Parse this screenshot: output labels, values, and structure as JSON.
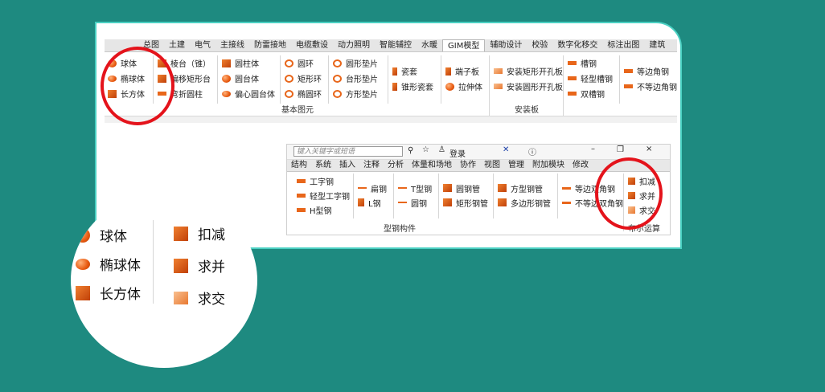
{
  "ribbon1": {
    "tabs": [
      "总图",
      "土建",
      "电气",
      "主接线",
      "防雷接地",
      "电缆敷设",
      "动力照明",
      "智能辅控",
      "水暖",
      "GIM模型",
      "辅助设计",
      "校验",
      "数字化移交",
      "标注出图",
      "建筑"
    ],
    "col1": [
      "球体",
      "椭球体",
      "长方体"
    ],
    "col2": [
      "棱台（锥）",
      "偏移矩形台",
      "弯折圆柱"
    ],
    "col3": [
      "圆柱体",
      "圆台体",
      "偏心圆台体"
    ],
    "col4": [
      "圆环",
      "矩形环",
      "椭圆环"
    ],
    "col5": [
      "圆形垫片",
      "台形垫片",
      "方形垫片"
    ],
    "col6": [
      "瓷套",
      "锥形瓷套"
    ],
    "col7": [
      "端子板",
      "拉伸体"
    ],
    "col8": [
      "安装矩形开孔板",
      "安装圆形开孔板"
    ],
    "col9": [
      "槽钢",
      "轻型槽钢",
      "双槽钢"
    ],
    "col10": [
      "等边角钢",
      "不等边角钢"
    ],
    "group1": "基本图元",
    "group2": "安装板"
  },
  "ribbon2": {
    "search_placeholder": "键入关键字或短语",
    "login": "登录",
    "tabs": [
      "结构",
      "系统",
      "插入",
      "注释",
      "分析",
      "体量和场地",
      "协作",
      "视图",
      "管理",
      "附加模块",
      "修改"
    ],
    "colA": [
      "工字钢",
      "轻型工字钢",
      "H型钢"
    ],
    "colB": [
      "扁钢",
      "L钢"
    ],
    "colC": [
      "T型钢",
      "圆钢"
    ],
    "colD": [
      "圆钢管",
      "矩形钢管"
    ],
    "colE": [
      "方型钢管",
      "多边形钢管"
    ],
    "colF": [
      "等边双角钢",
      "不等边双角钢"
    ],
    "colG": [
      "扣减",
      "求并",
      "求交"
    ],
    "group1": "型钢构件",
    "group2": "布尔运算"
  },
  "zoom": {
    "left": [
      "球体",
      "椭球体",
      "长方体"
    ],
    "right": [
      "扣减",
      "求并",
      "求交"
    ]
  },
  "colors": {
    "background": "#1e8a80",
    "accent": "#e8661a",
    "highlight": "#e4131b",
    "border": "#4ad0c2"
  }
}
